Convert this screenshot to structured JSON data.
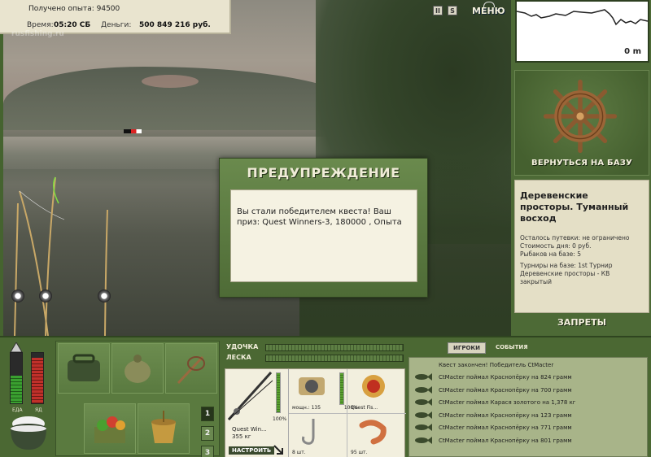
{
  "info": {
    "experience_label": "Получено опыта:",
    "experience_value": "94500",
    "time_label": "Время:",
    "time_value": "05:20 СБ",
    "money_label": "Деньги:",
    "money_value": "500 849 216 руб."
  },
  "watermark": "rusfishing.ru",
  "top_buttons": {
    "pause": "II",
    "sound": "S",
    "menu": "МЕНЮ"
  },
  "depth_graph": {
    "depth_label": "0 m"
  },
  "base": {
    "return_label": "ВЕРНУТЬСЯ НА БАЗУ",
    "location_title": "Деревенские просторы. Туманный восход",
    "details": [
      "Осталось путевки: не ограничено",
      "Стоимость дня: 0 руб.",
      "Рыбаков на базе: 5",
      "",
      "Турниры на базе: 1st Турнир",
      "Деревенские просторы - КВ",
      "закрытый"
    ],
    "bans_label": "ЗАПРЕТЫ"
  },
  "dialog": {
    "title": "ПРЕДУПРЕЖДЕНИЕ",
    "message": "Вы стали победителем квеста! Ваш приз: Quest Winners-3, 180000 , Опыта"
  },
  "gauges": {
    "food_label": "ЕДА",
    "poison_label": "ЯД",
    "food_level": 0.55,
    "poison_level": 0.9,
    "food_color": "#3aa030",
    "poison_color": "#c0302a"
  },
  "inventory": {
    "pages": [
      "1",
      "2",
      "3"
    ]
  },
  "tackle": {
    "rod_label": "УДОЧКА",
    "line_label": "ЛЕСКА",
    "rod_name": "Quest Win...",
    "rod_weight": "355 кг",
    "rod_pct": "100%",
    "setup_label": "НАСТРОИТЬ",
    "reel_caption": "мощн.: 135",
    "reel_pct": "100%",
    "bait_caption": "Quest Fis...",
    "hook_caption": "8 шт.",
    "shrimp_caption": "95 шт."
  },
  "events": {
    "tab_players": "ИГРОКИ",
    "tab_events": "СОБЫТИЯ",
    "header": "Квест закончен! Победитель CtMacter",
    "rows": [
      "CtMacter поймал Краснопёрку на 824 грамм",
      "CtMacter поймал Краснопёрку на 700 грамм",
      "CtMacter поймал Карася золотого на 1,378 кг",
      "CtMacter поймал Краснопёрку на 123 грамм",
      "CtMacter поймал Краснопёрку на 771 грамм",
      "CtMacter поймал Краснопёрку на 801 грамм"
    ]
  }
}
